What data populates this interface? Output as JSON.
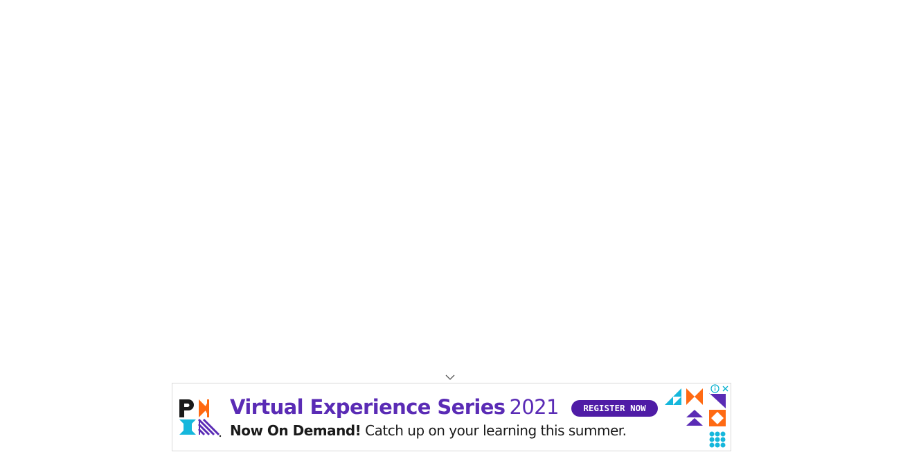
{
  "ad": {
    "brand_letters": "PMI",
    "headline": "Virtual Experience Series",
    "headline_year": "2021",
    "cta_label": "REGISTER NOW",
    "subline_bold": "Now On Demand!",
    "subline_rest": " Catch up on your learning this summer.",
    "colors": {
      "purple": "#5a2bb5",
      "dark_purple": "#4f1ca6",
      "cyan": "#16b7dc",
      "orange": "#ff6a13"
    },
    "controls": {
      "info_icon": "info-icon",
      "close_icon": "close-icon"
    }
  },
  "collapse_icon": "chevron-down-icon"
}
